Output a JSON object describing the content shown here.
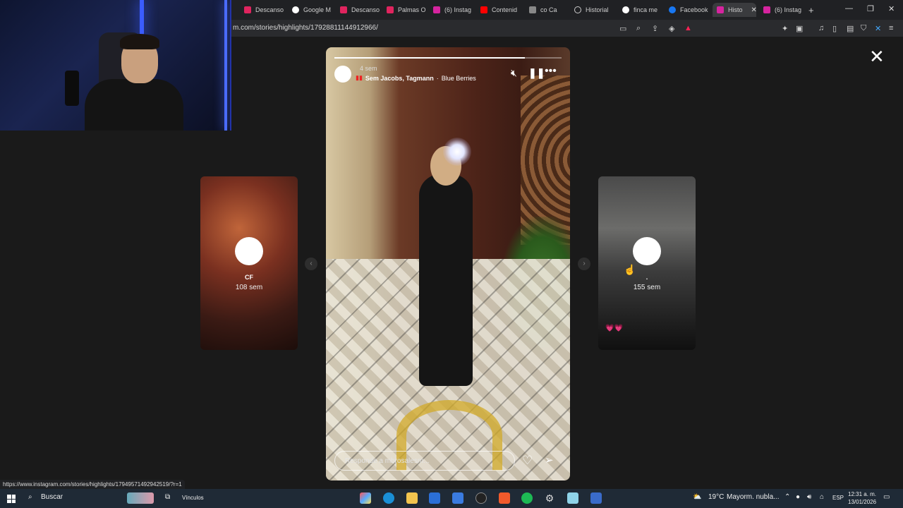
{
  "browser": {
    "tabs": [
      {
        "label": "Descanso",
        "color": "#e0245e"
      },
      {
        "label": "Google M",
        "color": "#ffffff"
      },
      {
        "label": "Descanso",
        "color": "#e0245e"
      },
      {
        "label": "Palmas O",
        "color": "#e0245e"
      },
      {
        "label": "(6) Instag",
        "color": "#d6249f"
      },
      {
        "label": "Contenid",
        "color": "#ff0000"
      },
      {
        "label": "co Ca",
        "color": "#888888"
      },
      {
        "label": "Historial",
        "color": "#cccccc"
      },
      {
        "label": "finca me",
        "color": "#ffffff"
      },
      {
        "label": "Facebook",
        "color": "#1877f2"
      },
      {
        "label": "Histo",
        "color": "#d6249f",
        "active": true
      },
      {
        "label": "(6) Instag",
        "color": "#d6249f"
      }
    ],
    "new_tab": "+",
    "url": "m.com/stories/highlights/17928811144912966/",
    "status_url": "https://www.instagram.com/stories/highlights/17949571492942519/?r=1"
  },
  "viewer": {
    "close_label": "✕",
    "main_story": {
      "time": "4 sem",
      "music_artist": "Sem Jacobs, Tagmann",
      "music_title": "Blue Berries",
      "progress": 0.84,
      "reply_placeholder": "Responde a mbrosalesm..."
    },
    "left_story": {
      "name": "CF",
      "time": "108 sem"
    },
    "right_story": {
      "name": ".",
      "time": "155 sem",
      "hearts": "💗💗"
    }
  },
  "taskbar": {
    "search_label": "Buscar",
    "links_label": "Vínculos",
    "weather_temp": "19°C",
    "weather_desc": "Mayorm. nubla...",
    "language": "ESP",
    "time": "12:31 a. m.",
    "date": "13/01/2026"
  },
  "icons": {
    "close": "close-icon",
    "mute": "mute-icon",
    "pause": "pause-icon",
    "more": "more-icon",
    "heart": "heart-icon",
    "send": "send-icon"
  }
}
